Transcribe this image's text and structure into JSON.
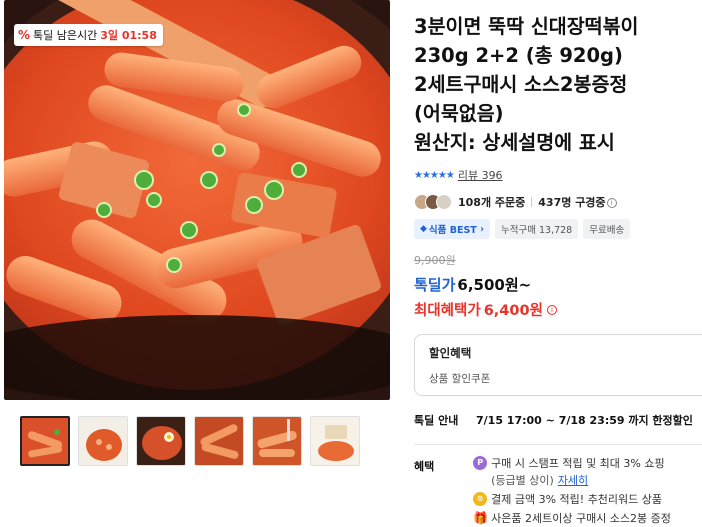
{
  "deal_timer": {
    "icon": "percent-icon",
    "label": "톡딜 남은시간",
    "time": "3일 01:58"
  },
  "product": {
    "title_lines": [
      "3분이면 뚝딱 신대장떡볶이",
      "230g 2+2 (총 920g)",
      "2세트구매시 소스2봉증정",
      "(어묵없음)",
      "원산지: 상세설명에 표시"
    ],
    "rating": {
      "stars": 5,
      "review_text": "리뷰 396"
    },
    "orders": {
      "order_count": "108개 주문중",
      "follower_count": "437명 구경중"
    },
    "tags": [
      {
        "label": "식품 BEST",
        "icon": "diamond-icon",
        "accent": "#2162d6"
      },
      {
        "label": "누적구매 13,728"
      },
      {
        "label": "무료배송"
      }
    ]
  },
  "price": {
    "original": "9,900원",
    "deal_label": "톡딜가",
    "deal_price": "6,500원~",
    "max_label": "최대혜택가",
    "max_price": "6,400원"
  },
  "coupon": {
    "title": "할인혜택",
    "subtitle": "상품 할인쿠폰"
  },
  "deal_info": {
    "label": "톡딜 안내",
    "value": "7/15 17:00 ~ 7/18 23:59 까지 한정할인"
  },
  "benefits": {
    "label": "혜택",
    "items": [
      {
        "icon": "p",
        "text": "구매 시 스탬프 적립 및 최대 3% 쇼핑",
        "sub": "(등급별 상이)",
        "link": "자세히"
      },
      {
        "icon": "coin",
        "text": "결제 금액 3% 적립! 추천리워드 상품"
      },
      {
        "icon": "gift",
        "text": "사은품 2세트이상 구매시 소스2봉 증정"
      }
    ]
  },
  "colors": {
    "accent_blue": "#2162d6",
    "accent_red": "#e8332a"
  }
}
